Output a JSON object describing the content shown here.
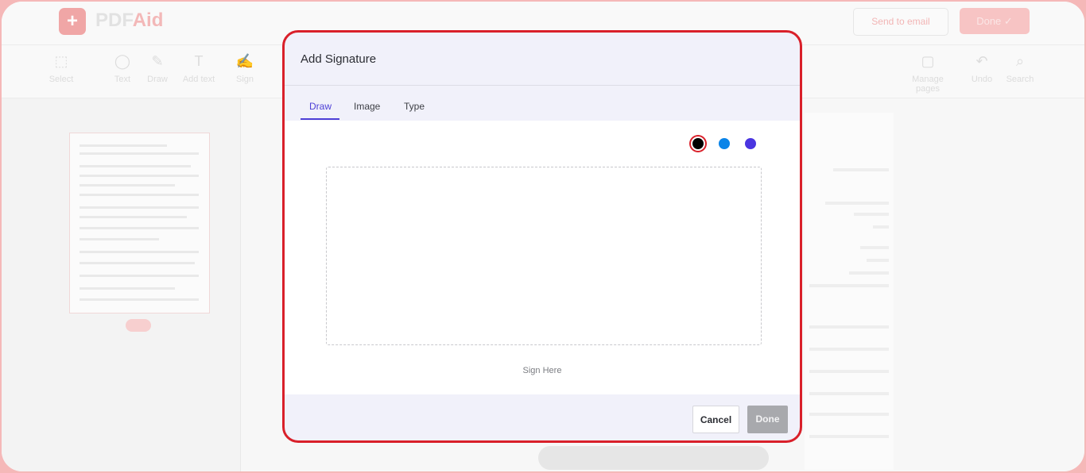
{
  "app": {
    "logo_mark": "+",
    "logo_text_a": "PDF",
    "logo_text_b": "Aid",
    "send_email_label": "Send to email",
    "done_top_label": "Done ✓",
    "tools": [
      {
        "label": "Select",
        "icon": "cursor-icon",
        "glyph": "⬚"
      },
      {
        "label": "Text",
        "icon": "text-tool-icon",
        "glyph": "◯"
      },
      {
        "label": "Draw",
        "icon": "pen-icon",
        "glyph": "✎"
      },
      {
        "label": "Add text",
        "icon": "add-text-icon",
        "glyph": "T"
      },
      {
        "label": "Sign",
        "icon": "signature-icon",
        "glyph": "✍"
      }
    ],
    "right_tools": [
      {
        "label": "Manage pages",
        "icon": "pages-icon",
        "glyph": "▢"
      },
      {
        "label": "Undo",
        "icon": "undo-icon",
        "glyph": "↶"
      },
      {
        "label": "Search",
        "icon": "search-icon",
        "glyph": "⌕"
      }
    ]
  },
  "modal": {
    "title": "Add Signature",
    "tabs": [
      {
        "label": "Draw",
        "active": true
      },
      {
        "label": "Image",
        "active": false
      },
      {
        "label": "Type",
        "active": false
      }
    ],
    "colors": [
      {
        "name": "black",
        "hex": "#000000",
        "selected": true
      },
      {
        "name": "blue",
        "hex": "#0a84e8",
        "selected": false
      },
      {
        "name": "indigo",
        "hex": "#4a35e0",
        "selected": false
      }
    ],
    "hint": "Sign Here",
    "cancel_label": "Cancel",
    "done_label": "Done"
  }
}
